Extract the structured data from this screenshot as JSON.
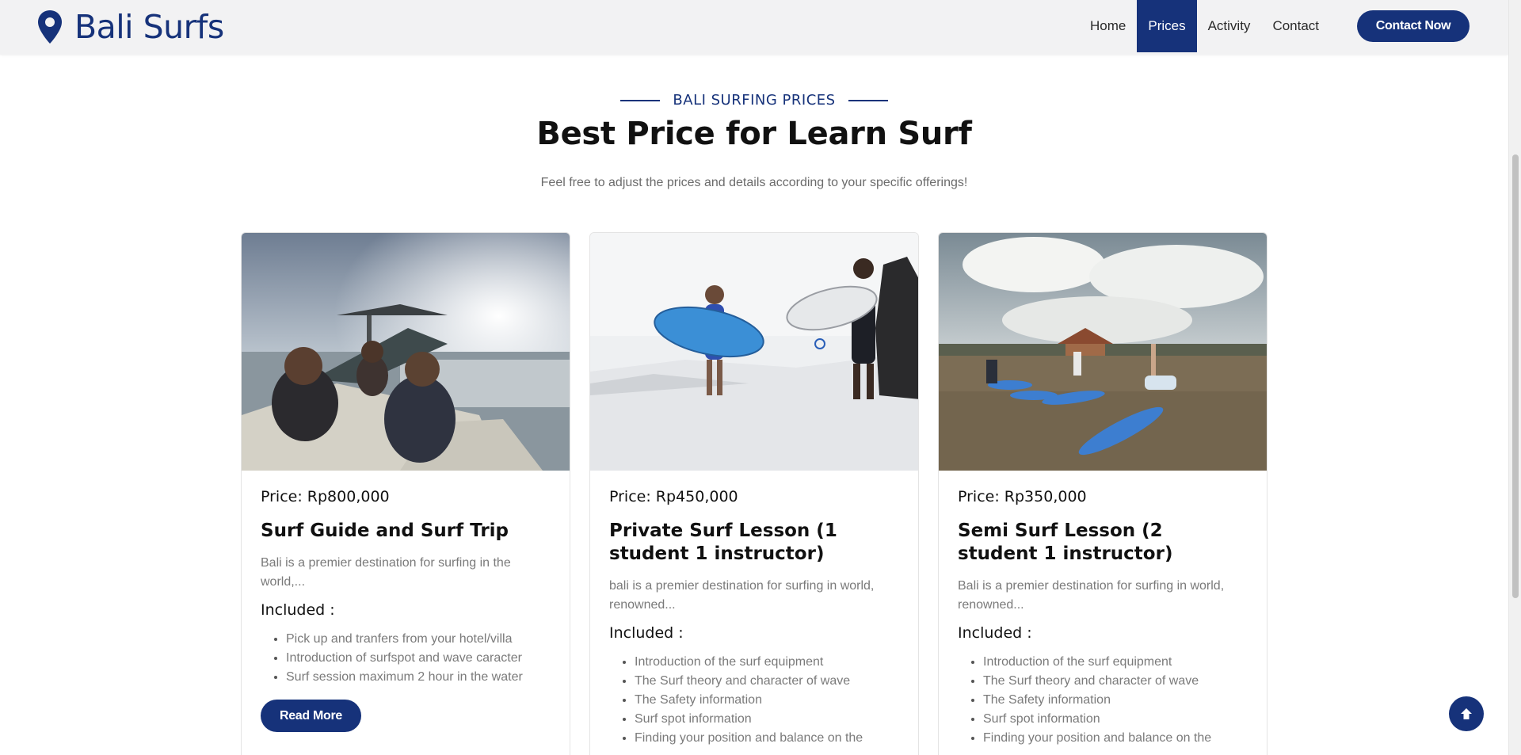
{
  "brand": {
    "name": "Bali Surfs",
    "icon": "map-pin-icon"
  },
  "nav": {
    "items": [
      {
        "label": "Home",
        "active": false
      },
      {
        "label": "Prices",
        "active": true
      },
      {
        "label": "Activity",
        "active": false
      },
      {
        "label": "Contact",
        "active": false
      }
    ],
    "cta_label": "Contact Now"
  },
  "section": {
    "kicker": "BALI SURFING PRICES",
    "title": "Best Price for Learn Surf",
    "subtitle": "Feel free to adjust the prices and details according to your specific offerings!"
  },
  "cards": [
    {
      "price": "Price: Rp800,000",
      "title": "Surf Guide and Surf Trip",
      "description": "Bali is a premier destination for surfing in the world,...",
      "included_label": "Included :",
      "items": [
        "Pick up and tranfers from your hotel/villa",
        "Introduction of surfspot and wave caracter",
        "Surf session maximum 2 hour in the water"
      ],
      "button": "Read More"
    },
    {
      "price": "Price: Rp450,000",
      "title": "Private Surf Lesson (1 student 1 instructor)",
      "description": "bali is a premier destination for surfing in world, renowned...",
      "included_label": "Included :",
      "items": [
        "Introduction of the surf equipment",
        "The Surf theory and character of wave",
        "The Safety information",
        "Surf spot information",
        "Finding your position and balance on the"
      ]
    },
    {
      "price": "Price: Rp350,000",
      "title": "Semi Surf Lesson (2 student 1 instructor)",
      "description": "Bali is a premier destination for surfing in world, renowned...",
      "included_label": "Included :",
      "items": [
        "Introduction of the surf equipment",
        "The Surf theory and character of wave",
        "The Safety information",
        "Surf spot information",
        "Finding your position and balance on the"
      ]
    }
  ],
  "colors": {
    "brand": "#16327a",
    "nav_bg": "#f2f2f3",
    "muted_text": "#7a7a7a"
  },
  "scroll_top_icon": "arrow-up-icon"
}
